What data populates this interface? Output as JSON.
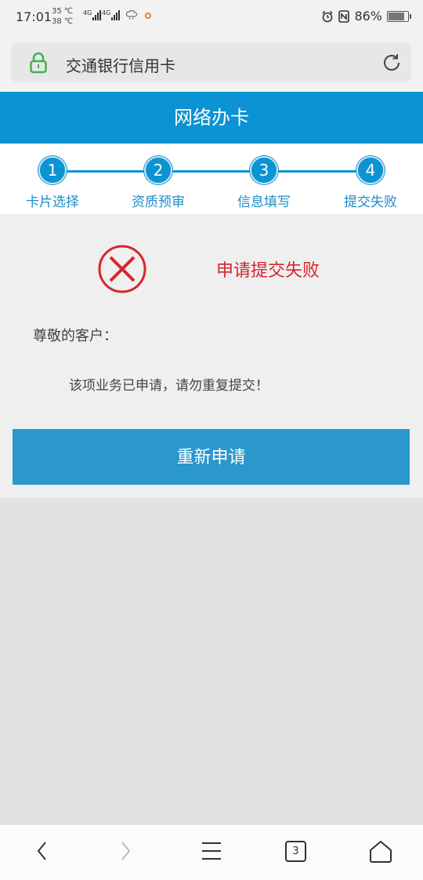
{
  "status": {
    "time": "17:01",
    "temp_hi": "35 ℃",
    "temp_lo": "38 ℃",
    "net1": "4G",
    "net2": "4G",
    "battery": "86%"
  },
  "address": {
    "title": "交通银行信用卡"
  },
  "header": {
    "title": "网络办卡"
  },
  "steps": [
    {
      "num": "1",
      "label": "卡片选择"
    },
    {
      "num": "2",
      "label": "资质预审"
    },
    {
      "num": "3",
      "label": "信息填写"
    },
    {
      "num": "4",
      "label": "提交失败"
    }
  ],
  "result": {
    "title": "申请提交失败",
    "greeting": "尊敬的客户：",
    "message": "该项业务已申请，请勿重复提交！",
    "button": "重新申请"
  },
  "bottom_nav": {
    "tab_count": "3"
  },
  "colors": {
    "brand": "#0b93d4",
    "error": "#d8252c",
    "button": "#2a97cd"
  }
}
